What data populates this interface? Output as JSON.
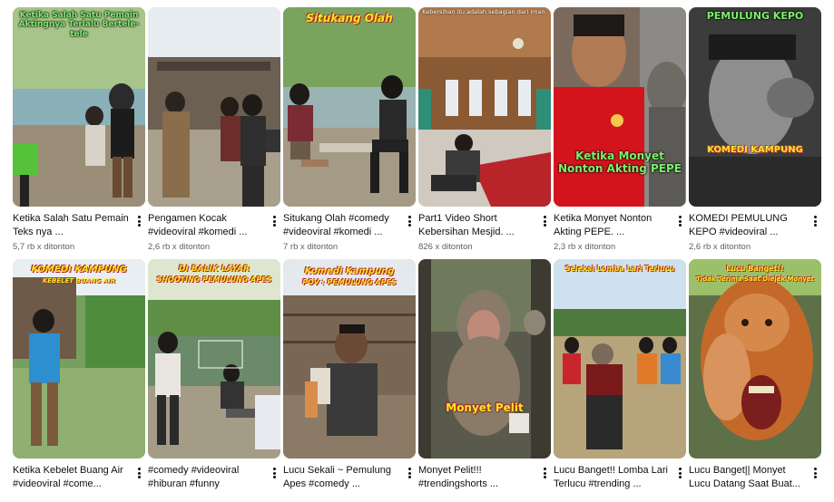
{
  "videos": [
    {
      "title": "Ketika Salah Satu Pemain Teks nya ...",
      "views": "5,7 rb x ditonton",
      "overlay": "Ketika Salah Satu Pemain Aktingnya Terlalu Bertele-tele"
    },
    {
      "title": "Pengamen Kocak #videoviral #komedi ...",
      "views": "2,6 rb x ditonton",
      "overlay": ""
    },
    {
      "title": "Situkang Olah #comedy #videoviral #komedi ...",
      "views": "7 rb x ditonton",
      "overlay": "Situkang Olah"
    },
    {
      "title": "Part1 Video Short Kebersihan Mesjid. ...",
      "views": "826 x ditonton",
      "overlay": "Kebersihan itu adalah sebagian dari iman."
    },
    {
      "title": "Ketika Monyet Nonton Akting PEPE. ...",
      "views": "2,3 rb x ditonton",
      "overlay": "Ketika Monyet Nonton Akting PEPE"
    },
    {
      "title": "KOMEDI PEMULUNG KEPO #videoviral ...",
      "views": "2,6 rb x ditonton",
      "overlay": "PEMULUNG KEPO",
      "overlay2": "KOMEDI KAMPUNG"
    },
    {
      "title": "Ketika Kebelet Buang Air #videoviral #come...",
      "views": "",
      "overlay": "KOMEDI KAMPUNG",
      "overlay2": "KEBELET BUANG AIR"
    },
    {
      "title": "#comedy #videoviral #hiburan #funny",
      "views": "",
      "overlay": "DI BALIK LAYAR",
      "overlay2": "SHOOTING PEMULUNG APES"
    },
    {
      "title": "Lucu Sekali ~ Pemulung Apes #comedy ...",
      "views": "",
      "overlay": "Komedi Kampung",
      "overlay2": "POV : PEMULUNG APES"
    },
    {
      "title": "Monyet Pelit!!! #trendingshorts ...",
      "views": "",
      "overlay": "Monyet Pelit"
    },
    {
      "title": "Lucu Banget!! Lomba Lari Terlucu #trending ...",
      "views": "",
      "overlay": "Seleksi Lomba Lari Terlucu"
    },
    {
      "title": "Lucu Banget|| Monyet Lucu Datang Saat Buat...",
      "views": "",
      "overlay": "Lucu Banget!!",
      "overlay2": "Tidak Terima Saat Diejek Monyet"
    }
  ],
  "colors": {
    "title": "#0f0f0f",
    "meta": "#606060",
    "overlay_yellow": "#f5e52b",
    "overlay_green": "#7cf06a"
  }
}
